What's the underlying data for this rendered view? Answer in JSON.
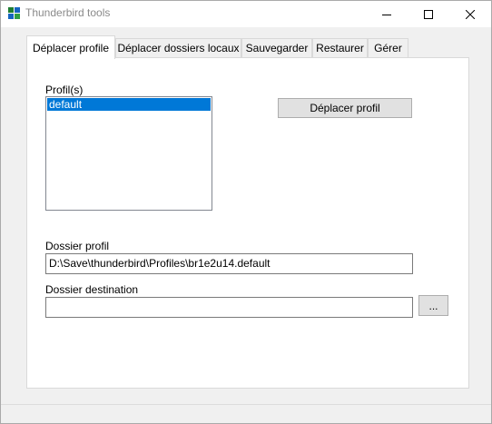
{
  "window": {
    "title": "Thunderbird tools",
    "icon": "thunderbird-tools-icon"
  },
  "tabs": [
    {
      "label": "Déplacer profile",
      "active": true
    },
    {
      "label": "Déplacer dossiers locaux",
      "active": false
    },
    {
      "label": "Sauvegarder",
      "active": false
    },
    {
      "label": "Restaurer",
      "active": false
    },
    {
      "label": "Gérer",
      "active": false
    }
  ],
  "move_profile": {
    "profiles_label": "Profil(s)",
    "profiles": [
      "default"
    ],
    "selected_profile": "default",
    "move_button_label": "Déplacer profil",
    "profile_folder_label": "Dossier profil",
    "profile_folder_value": "D:\\Save\\thunderbird\\Profiles\\br1e2u14.default",
    "destination_label": "Dossier destination",
    "destination_value": "",
    "browse_button_label": "..."
  },
  "colors": {
    "selection": "#0078d7",
    "window_bg": "#f0f0f0",
    "panel_bg": "#ffffff"
  }
}
